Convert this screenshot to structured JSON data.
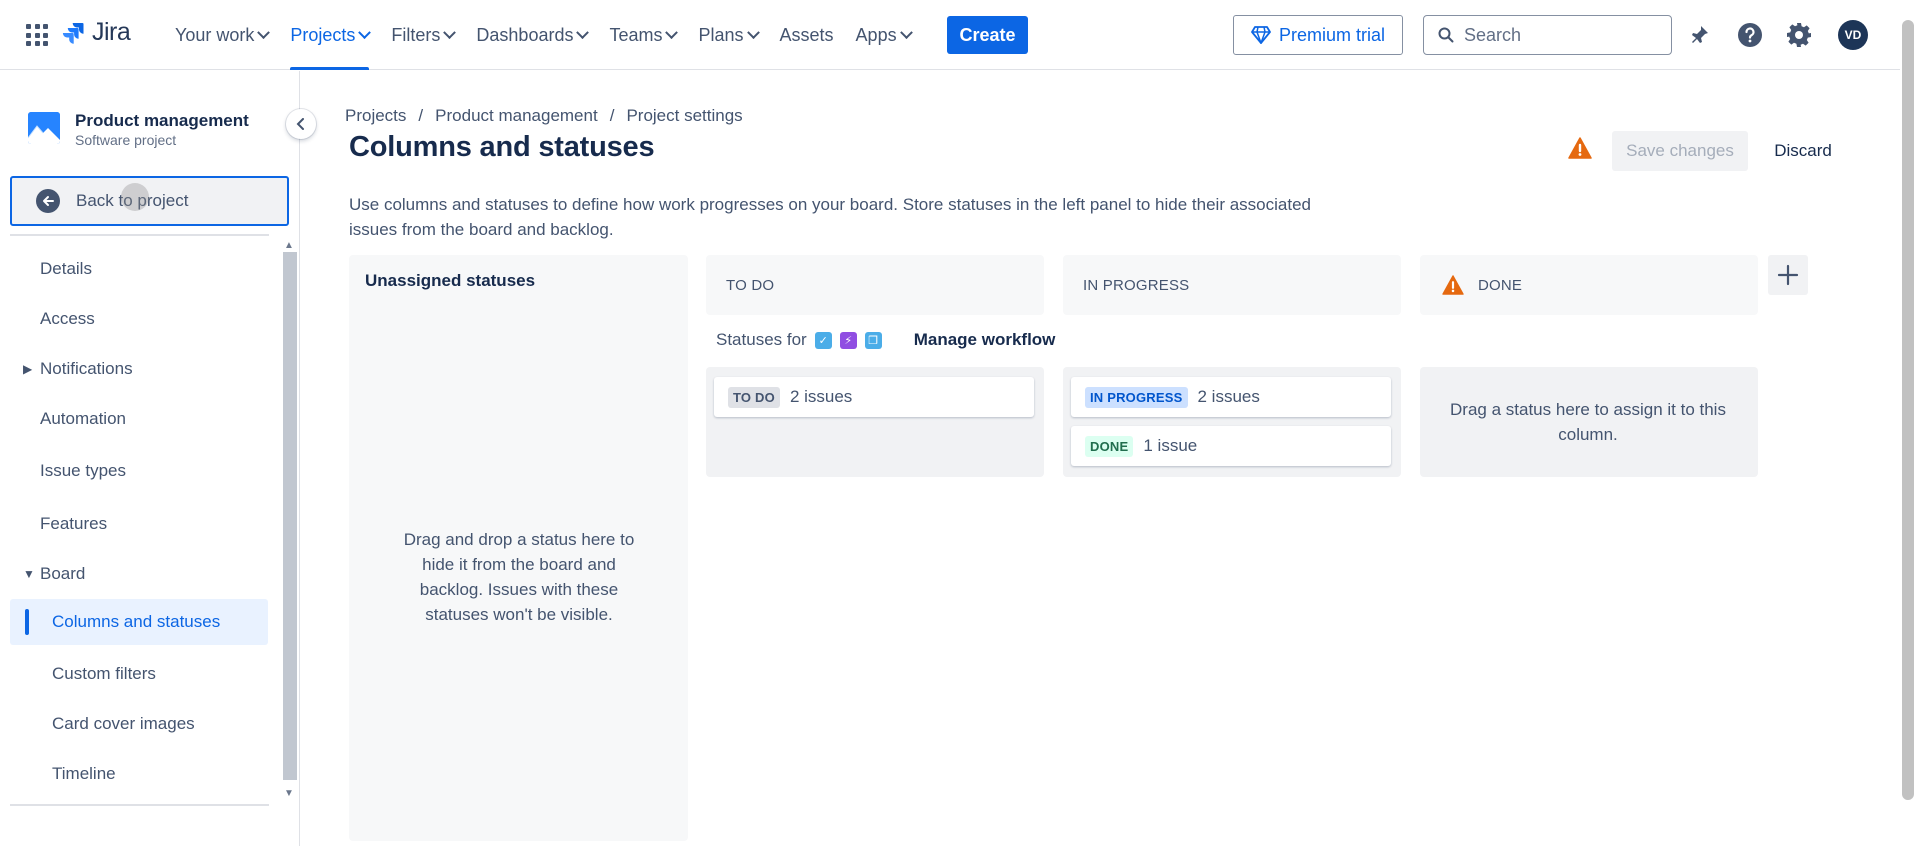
{
  "topbar": {
    "logo_text": "Jira",
    "nav": [
      {
        "label": "Your work",
        "has_dropdown": true,
        "active": false
      },
      {
        "label": "Projects",
        "has_dropdown": true,
        "active": true
      },
      {
        "label": "Filters",
        "has_dropdown": true,
        "active": false
      },
      {
        "label": "Dashboards",
        "has_dropdown": true,
        "active": false
      },
      {
        "label": "Teams",
        "has_dropdown": true,
        "active": false
      },
      {
        "label": "Plans",
        "has_dropdown": true,
        "active": false
      },
      {
        "label": "Assets",
        "has_dropdown": false,
        "active": false
      },
      {
        "label": "Apps",
        "has_dropdown": true,
        "active": false
      }
    ],
    "create_label": "Create",
    "premium_label": "Premium trial",
    "search_placeholder": "Search",
    "avatar_initials": "VD",
    "icons": [
      "app-switcher-icon",
      "notifications-icon",
      "help-icon",
      "settings-icon"
    ]
  },
  "sidebar": {
    "project_name": "Product management",
    "project_type": "Software project",
    "back_label": "Back to project",
    "items": [
      {
        "label": "Details"
      },
      {
        "label": "Access"
      },
      {
        "label": "Notifications"
      },
      {
        "label": "Automation"
      },
      {
        "label": "Issue types"
      },
      {
        "label": "Features"
      },
      {
        "label": "Board"
      },
      {
        "label": "Columns and statuses"
      },
      {
        "label": "Custom filters"
      },
      {
        "label": "Card cover images"
      },
      {
        "label": "Timeline"
      }
    ]
  },
  "main": {
    "breadcrumb": [
      "Projects",
      "Product management",
      "Project settings"
    ],
    "title": "Columns and statuses",
    "save_label": "Save changes",
    "discard_label": "Discard",
    "description": "Use columns and statuses to define how work progresses on your board. Store statuses in the left panel to hide their associated issues from the board and backlog.",
    "unassigned": {
      "title": "Unassigned statuses",
      "hint": "Drag and drop a status here to hide it from the board and backlog. Issues with these statuses won't be visible."
    },
    "statuses_for_label": "Statuses for",
    "manage_workflow_label": "Manage workflow",
    "columns": [
      {
        "name": "TO DO",
        "statuses": [
          {
            "lozenge": "TO DO",
            "count": "2 issues",
            "color": "#dfe1e6"
          }
        ]
      },
      {
        "name": "IN PROGRESS",
        "statuses": [
          {
            "lozenge": "IN PROGRESS",
            "count": "2 issues",
            "color": "#cce0ff"
          },
          {
            "lozenge": "DONE",
            "count": "1 issue",
            "color": "#dcfff1"
          }
        ]
      },
      {
        "name": "DONE",
        "warning": true,
        "hint": "Drag a status here to assign it to this column."
      }
    ]
  },
  "colors": {
    "brand_blue": "#0c66e4",
    "warning_orange": "#e56910",
    "text": "#172b4d",
    "subtle_text": "#44546f"
  }
}
